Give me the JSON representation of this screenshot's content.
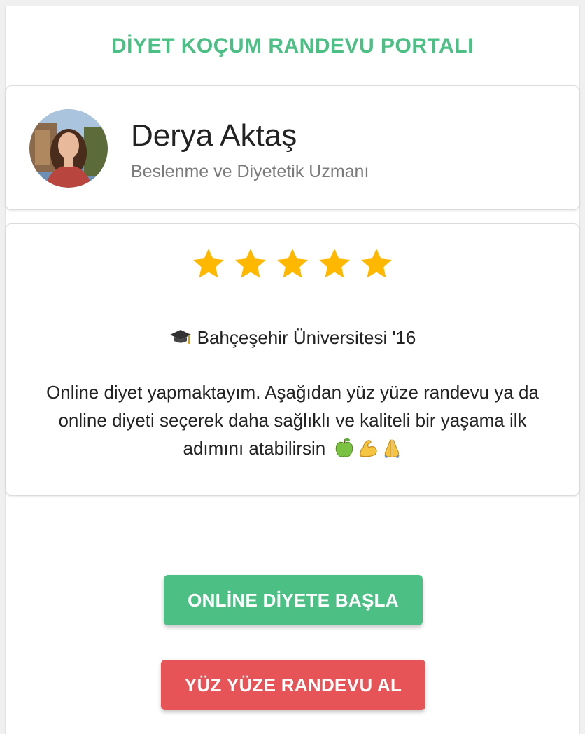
{
  "header": {
    "title": "DİYET KOÇUM RANDEVU PORTALI"
  },
  "profile": {
    "name": "Derya Aktaş",
    "title": "Beslenme ve Diyetetik Uzmanı"
  },
  "rating": {
    "stars": 5,
    "max": 5
  },
  "education": {
    "icon": "graduation-cap-icon",
    "text": "Bahçeşehir Üniversitesi '16"
  },
  "bio": {
    "text": "Online diyet yapmaktayım. Aşağıdan yüz yüze randevu ya da online diyeti seçerek daha sağlıklı ve kaliteli bir yaşama ilk adımını atabilirsin",
    "emojis": [
      "green-apple-icon",
      "flexed-biceps-icon",
      "folded-hands-icon"
    ]
  },
  "actions": {
    "online_label": "ONLİNE DİYETE BAŞLA",
    "face_to_face_label": "YÜZ YÜZE RANDEVU AL"
  },
  "colors": {
    "brand_green": "#4cbf85",
    "accent_red": "#e65457",
    "star": "#ffb800"
  }
}
